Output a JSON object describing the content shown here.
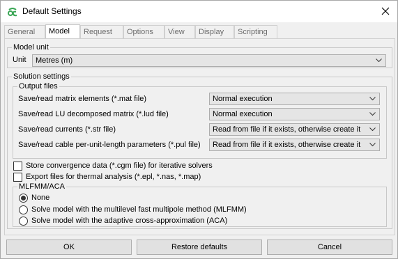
{
  "window": {
    "title": "Default Settings"
  },
  "tabs": [
    {
      "label": "General"
    },
    {
      "label": "Model"
    },
    {
      "label": "Request"
    },
    {
      "label": "Options"
    },
    {
      "label": "View"
    },
    {
      "label": "Display"
    },
    {
      "label": "Scripting"
    }
  ],
  "active_tab": "Model",
  "model_unit": {
    "legend": "Model unit",
    "label": "Unit",
    "value": "Metres (m)"
  },
  "solution_settings": {
    "legend": "Solution settings",
    "output_files": {
      "legend": "Output files",
      "rows": [
        {
          "label": "Save/read matrix elements (*.mat file)",
          "value": "Normal execution"
        },
        {
          "label": "Save/read LU decomposed matrix (*.lud file)",
          "value": "Normal execution"
        },
        {
          "label": "Save/read currents (*.str file)",
          "value": "Read from file if it exists, otherwise create it"
        },
        {
          "label": "Save/read cable per-unit-length parameters (*.pul file)",
          "value": "Read from file if it exists, otherwise create it"
        }
      ]
    },
    "checkboxes": [
      {
        "label": "Store convergence data (*.cgm file) for iterative solvers",
        "checked": false
      },
      {
        "label": "Export files for thermal analysis (*.epl, *.nas, *.map)",
        "checked": false
      }
    ],
    "mlfmm": {
      "legend": "MLFMM/ACA",
      "options": [
        {
          "label": "None",
          "selected": true
        },
        {
          "label": "Solve model with the multilevel fast multipole method (MLFMM)",
          "selected": false
        },
        {
          "label": "Solve model with the adaptive cross-approximation (ACA)",
          "selected": false
        }
      ]
    }
  },
  "buttons": {
    "ok": "OK",
    "restore": "Restore defaults",
    "cancel": "Cancel"
  },
  "colors": {
    "logo_green": "#3aa655",
    "window_bg": "#f0f0f0"
  },
  "icons": {
    "app": "feko-logo-icon",
    "close": "close-icon",
    "dropdown": "chevron-down-icon"
  }
}
